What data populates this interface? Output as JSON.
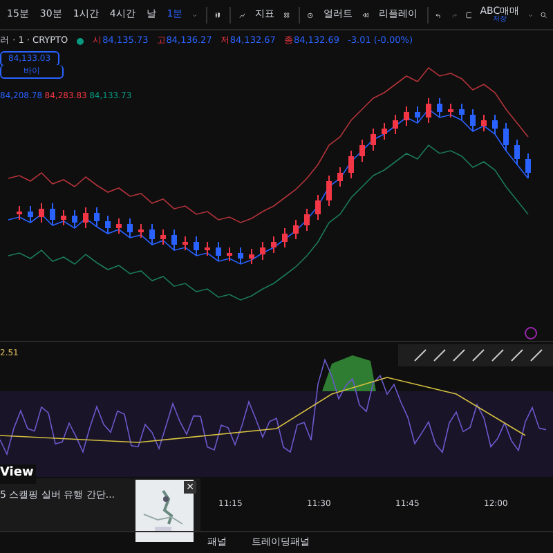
{
  "toolbar": {
    "intervals": [
      {
        "label": "15분",
        "selected": false
      },
      {
        "label": "30분",
        "selected": false
      },
      {
        "label": "1시간",
        "selected": false
      },
      {
        "label": "4시간",
        "selected": false
      },
      {
        "label": "날",
        "selected": false
      },
      {
        "label": "1분",
        "selected": true
      }
    ],
    "indicators": "지표",
    "alert": "얼러트",
    "replay": "리플레이",
    "layout_name": "ABC매매",
    "layout_status": "저장"
  },
  "legend": {
    "symbol": "러 · 1 · CRYPTO",
    "values": [
      {
        "label": "시",
        "value": "84,135.73"
      },
      {
        "label": "고",
        "value": "84,136.27"
      },
      {
        "label": "저",
        "value": "84,132.67"
      },
      {
        "label": "종",
        "value": "84,132.69"
      }
    ],
    "change": "-3.01 (-0.00%)"
  },
  "price_badge": {
    "price": "84,133.03",
    "action": "바이"
  },
  "bands": [
    {
      "value": "84,208.78",
      "color": "#2962ff"
    },
    {
      "value": "84,283.83",
      "color": "#f23645"
    },
    {
      "value": "84,133.73",
      "color": "#089981"
    }
  ],
  "rsi": {
    "value": "2.51"
  },
  "time_axis": [
    "11:15",
    "11:30",
    "11:45",
    "12:00"
  ],
  "popup": {
    "brand": "View",
    "title": "5 스캘핑 실버 유행 간단...",
    "close": "×"
  },
  "bottom_tabs": [
    "패널",
    "트레이딩패널"
  ]
}
